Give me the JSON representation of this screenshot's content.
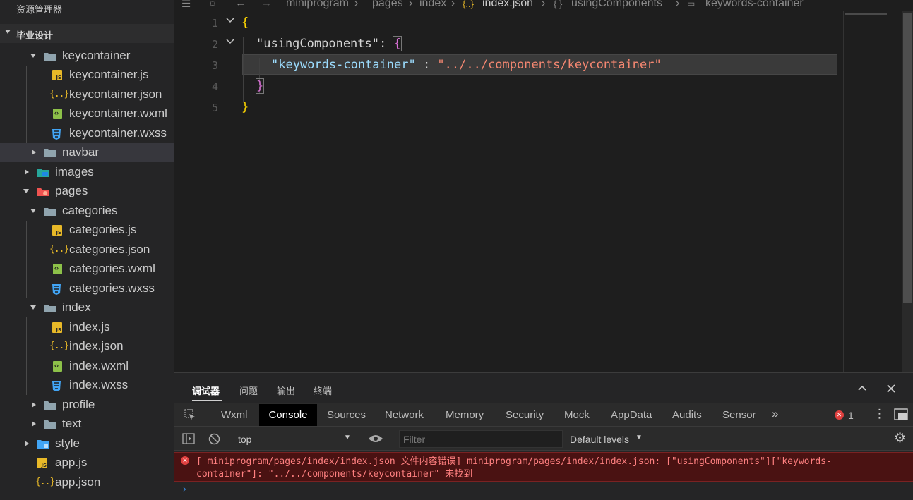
{
  "sidebar": {
    "title": "资源管理器",
    "section": "毕业设计",
    "items": [
      {
        "label": "keycontainer",
        "type": "folder-open"
      },
      {
        "label": "keycontainer.js",
        "type": "js"
      },
      {
        "label": "keycontainer.json",
        "type": "json"
      },
      {
        "label": "keycontainer.wxml",
        "type": "wxml"
      },
      {
        "label": "keycontainer.wxss",
        "type": "wxss"
      },
      {
        "label": "navbar",
        "type": "folder"
      },
      {
        "label": "images",
        "type": "folder-images"
      },
      {
        "label": "pages",
        "type": "folder-pages"
      },
      {
        "label": "categories",
        "type": "folder-open"
      },
      {
        "label": "categories.js",
        "type": "js"
      },
      {
        "label": "categories.json",
        "type": "json"
      },
      {
        "label": "categories.wxml",
        "type": "wxml"
      },
      {
        "label": "categories.wxss",
        "type": "wxss"
      },
      {
        "label": "index",
        "type": "folder-open"
      },
      {
        "label": "index.js",
        "type": "js"
      },
      {
        "label": "index.json",
        "type": "json"
      },
      {
        "label": "index.wxml",
        "type": "wxml"
      },
      {
        "label": "index.wxss",
        "type": "wxss"
      },
      {
        "label": "profile",
        "type": "folder"
      },
      {
        "label": "text",
        "type": "folder"
      },
      {
        "label": "style",
        "type": "folder-style"
      },
      {
        "label": "app.js",
        "type": "js"
      },
      {
        "label": "app.json",
        "type": "json"
      }
    ]
  },
  "editor": {
    "breadcrumb": [
      "miniprogram",
      "pages",
      "index",
      "index.json",
      "usingComponents",
      "keywords-container"
    ],
    "line_numbers": [
      "1",
      "2",
      "3",
      "4",
      "5"
    ],
    "code": {
      "l1_brace": "{",
      "l2_key": "\"usingComponents\"",
      "l2_colon": ": ",
      "l2_brace": "{",
      "l3_key": "\"keywords-container\"",
      "l3_colon": " : ",
      "l3_value": "\"../../components/keycontainer\"",
      "l4_brace": "}",
      "l5_brace": "}"
    },
    "colors": {
      "key": "#9cdcfe",
      "string": "#f48771",
      "brace": "#ffd700"
    }
  },
  "panel": {
    "tabs": [
      "调试器",
      "问题",
      "输出",
      "终端"
    ],
    "devtools_tabs": [
      "Wxml",
      "Console",
      "Sources",
      "Network",
      "Memory",
      "Security",
      "Mock",
      "AppData",
      "Audits",
      "Sensor"
    ],
    "more_tabs": "»",
    "error_count": "1",
    "context": "top",
    "filter_placeholder": "Filter",
    "levels": "Default levels",
    "error_message": "[ miniprogram/pages/index/index.json 文件内容错误] miniprogram/pages/index/index.json: [\"usingComponents\"][\"keywords-container\"]: \"../../components/keycontainer\" 未找到",
    "prompt": "›"
  }
}
